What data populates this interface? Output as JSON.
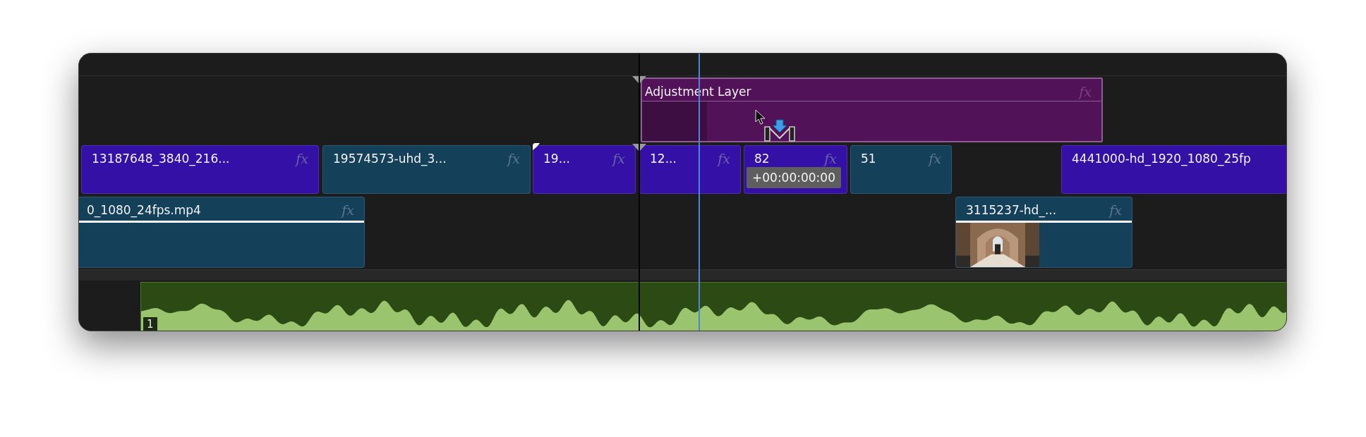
{
  "video_tracks": [
    {
      "clips": [
        {
          "title": "Adjustment Layer",
          "fx": "fx",
          "color": "#521258",
          "kind": "adjustment",
          "header_rule": false,
          "thumbnail": false
        }
      ]
    },
    {
      "clips": [
        {
          "title": "13187648_3840_216...",
          "fx": "fx",
          "color": "#3510a6",
          "kind": "video",
          "header_rule": false,
          "thumbnail": false
        },
        {
          "title": "19574573-uhd_3...",
          "fx": "fx",
          "color": "#14405a",
          "kind": "video",
          "header_rule": false,
          "thumbnail": false
        },
        {
          "title": "19...",
          "fx": "fx",
          "color": "#3510a6",
          "kind": "video",
          "header_rule": false,
          "thumbnail": false
        },
        {
          "title": "12...",
          "fx": "fx",
          "color": "#3510a6",
          "kind": "video",
          "header_rule": false,
          "thumbnail": false
        },
        {
          "title": "82",
          "fx": "fx",
          "color": "#3510a6",
          "kind": "video",
          "header_rule": false,
          "thumbnail": false
        },
        {
          "title": "51",
          "fx": "fx",
          "color": "#14405a",
          "kind": "video",
          "header_rule": false,
          "thumbnail": false
        },
        {
          "title": "4441000-hd_1920_1080_25fp",
          "color": "#3510a6",
          "kind": "video",
          "header_rule": false,
          "thumbnail": false
        }
      ]
    },
    {
      "clips": [
        {
          "title": "0_1080_24fps.mp4",
          "fx": "fx",
          "color": "#14405a",
          "kind": "video",
          "header_rule": true,
          "thumbnail": false
        },
        {
          "title": "3115237-hd_...",
          "fx": "fx",
          "color": "#14405a",
          "kind": "video",
          "header_rule": true,
          "thumbnail": true
        }
      ]
    }
  ],
  "audio_track": {
    "clips": [
      {
        "label": "1",
        "kind": "audio"
      }
    ]
  },
  "tooltip": "+00:00:00:00"
}
